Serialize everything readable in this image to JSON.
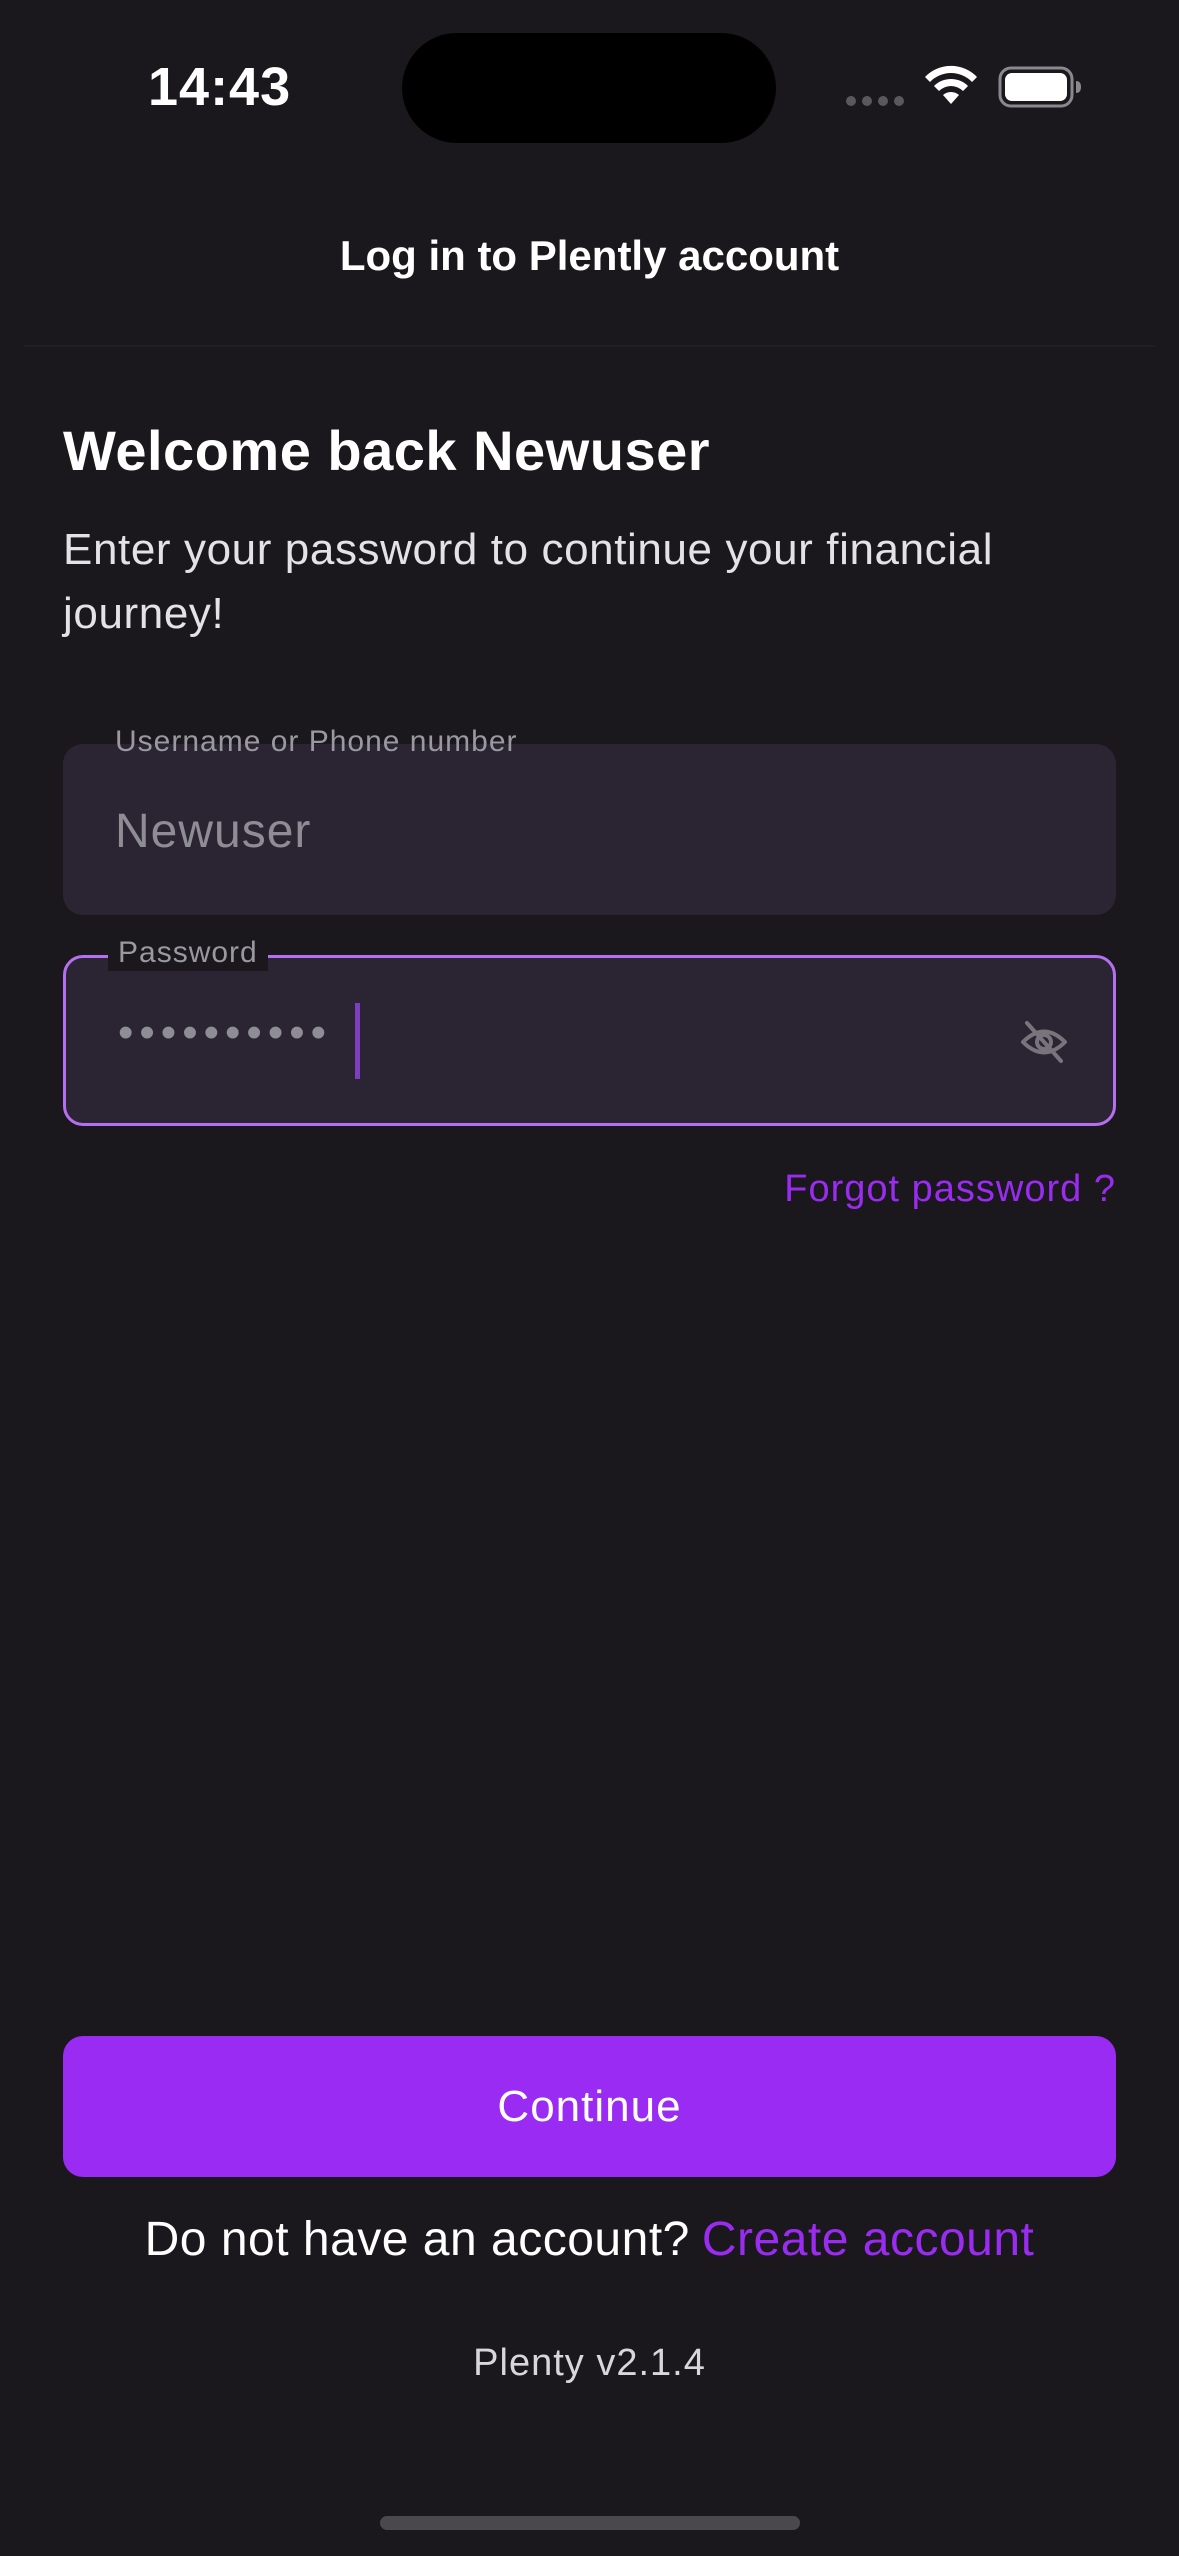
{
  "status_bar": {
    "time": "14:43",
    "icons": [
      "cellular-signal-icon",
      "wifi-icon",
      "battery-icon"
    ]
  },
  "header": {
    "title": "Log in to Plently account"
  },
  "main": {
    "welcome": "Welcome back Newuser",
    "subtitle": "Enter your password to continue your financial journey!",
    "username_field": {
      "label": "Username or Phone number",
      "value": "Newuser"
    },
    "password_field": {
      "label": "Password",
      "masked_value": "••••••••••",
      "toggle_icon": "eye-off-icon"
    },
    "forgot_password": "Forgot password ?"
  },
  "footer": {
    "continue_label": "Continue",
    "no_account_text": "Do not have an account?",
    "create_account_label": "Create account",
    "version": "Plenty v2.1.4"
  },
  "colors": {
    "background": "#1a181c",
    "accent": "#9a2bf2",
    "field_background": "#2b2533",
    "focus_border": "#b66ff0"
  }
}
